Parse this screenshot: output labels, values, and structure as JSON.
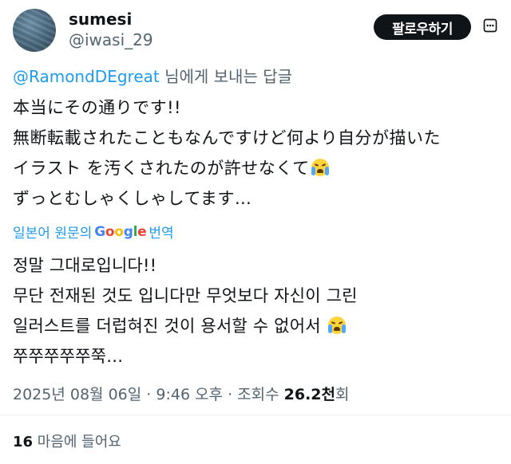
{
  "author": {
    "display_name": "sumesi",
    "handle": "@iwasi_29"
  },
  "follow_button": {
    "label": "팔로우하기"
  },
  "more_icon": "more-options-icon",
  "reply_context": {
    "mention": "@RamondDEgreat",
    "suffix": " 님에게 보내는 답글"
  },
  "tweet_text_ja": [
    "本当にその通りです!!",
    "無断転載されたこともなんですけど何より自分が描いた",
    "イラスト を汚くされたのが許せなくて",
    "ずっとむしゃくしゃしてます…"
  ],
  "translate_link": {
    "prefix": "일본어 원문의",
    "google": "Google",
    "suffix": "번역"
  },
  "google_colors": [
    "#4285F4",
    "#EA4335",
    "#FBBC05",
    "#4285F4",
    "#34A853",
    "#EA4335"
  ],
  "tweet_text_ko": [
    "정말 그대로입니다!!",
    "무단 전재된 것도 입니다만 무엇보다 자신이 그린",
    "일러스트를 더럽혀진 것이 용서할 수 없어서",
    "쭈쭈쭈쭈쭈쭉…"
  ],
  "emoji": "loudly-crying-face",
  "meta": {
    "date": "2025년 08월 06일",
    "separator1": " · ",
    "time": "9:46 오후",
    "separator2": " · ",
    "views_label": "조회수 ",
    "views_value": "26.2천",
    "views_suffix": "회"
  },
  "likes": {
    "count": "16",
    "label": " 마음에 들어요"
  },
  "colors": {
    "link": "#1d9bf0",
    "secondary_text": "#536471",
    "primary_text": "#0f1419",
    "button_bg": "#0f1419"
  }
}
